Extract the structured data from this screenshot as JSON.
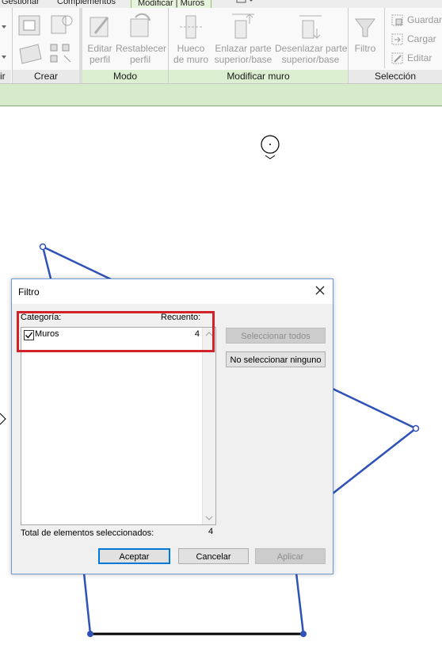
{
  "ribbon": {
    "tabs": [
      "Gestionar",
      "Complementos",
      "Modificar | Muros"
    ],
    "active_tab": "Modificar | Muros",
    "panels": {
      "left_cut": "ir",
      "crear": "Crear",
      "modo": "Modo",
      "modificar_muro": "Modificar muro",
      "seleccion": "Selección"
    },
    "buttons": {
      "editar_perfil": [
        "Editar",
        "perfil"
      ],
      "restablecer_perfil": [
        "Restablecer",
        "perfil"
      ],
      "hueco_muro": [
        "Hueco",
        "de muro"
      ],
      "enlazar": [
        "Enlazar parte",
        "superior/base"
      ],
      "desenlazar": [
        "Desenlazar parte",
        "superior/base"
      ],
      "filtro": "Filtro",
      "guardar": "Guardar",
      "cargar": "Cargar",
      "editar": "Editar"
    },
    "icons": [
      "clipboard-icon",
      "wall-shapes-icon",
      "edit-profile-icon",
      "reset-profile-icon",
      "wall-opening-icon",
      "attach-top-base-icon",
      "detach-top-base-icon",
      "filter-icon",
      "save-selection-icon",
      "load-selection-icon",
      "edit-selection-icon"
    ]
  },
  "dialog": {
    "title": "Filtro",
    "category_header": "Categoría:",
    "count_header": "Recuento:",
    "items": [
      {
        "label": "Muros",
        "count": "4",
        "checked": true
      }
    ],
    "select_all": "Seleccionar todos",
    "select_none": "No seleccionar ninguno",
    "total_label": "Total de elementos seleccionados:",
    "total_value": "4",
    "ok": "Aceptar",
    "cancel": "Cancelar",
    "apply": "Aplicar"
  },
  "colors": {
    "wall_selected": "#2e52b8",
    "highlight": "#d2232a",
    "ribbon_green": "#dcefd0"
  }
}
